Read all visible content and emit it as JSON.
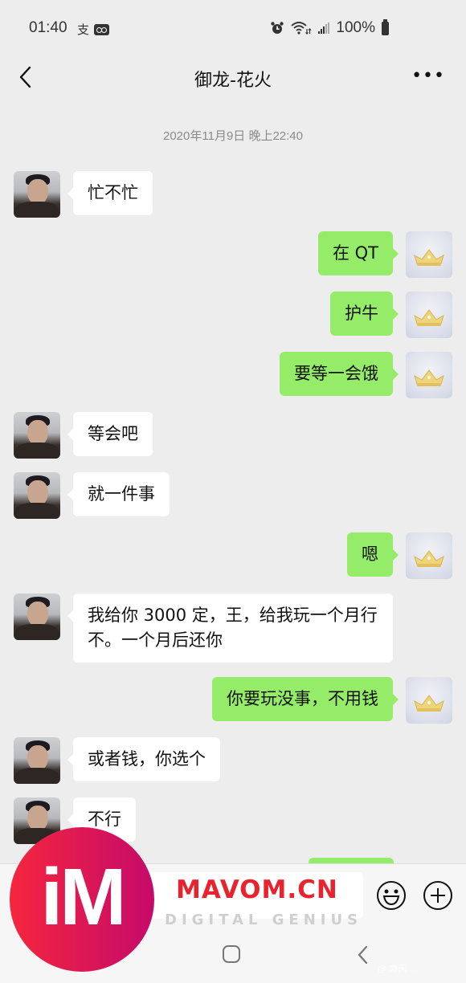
{
  "status_bar": {
    "time": "01:40",
    "left_icons": [
      "alipay-icon",
      "voicemail-icon"
    ],
    "alipay_glyph": "支",
    "right_icons": [
      "alarm-icon",
      "wifi-icon",
      "signal-icon",
      "battery-icon"
    ],
    "battery": "100%"
  },
  "header": {
    "back_icon": "chevron-left-icon",
    "title": "御龙-花火",
    "more_label": "•••"
  },
  "timestamp": "2020年11月9日 晚上22:40",
  "messages": [
    {
      "side": "left",
      "sender": "friend",
      "text": "忙不忙"
    },
    {
      "side": "right",
      "sender": "me",
      "text": "在 QT"
    },
    {
      "side": "right",
      "sender": "me",
      "text": "护牛"
    },
    {
      "side": "right",
      "sender": "me",
      "text": "要等一会饿"
    },
    {
      "side": "left",
      "sender": "friend",
      "text": "等会吧"
    },
    {
      "side": "left",
      "sender": "friend",
      "text": "就一件事"
    },
    {
      "side": "right",
      "sender": "me",
      "text": "嗯"
    },
    {
      "side": "left",
      "sender": "friend",
      "text": "我给你 3000 定，王，给我玩一个月行不。一个月后还你"
    },
    {
      "side": "right",
      "sender": "me",
      "text": "你要玩没事，不用钱"
    },
    {
      "side": "left",
      "sender": "friend",
      "text": "或者钱，你选个"
    },
    {
      "side": "left",
      "sender": "friend",
      "text": "不行"
    }
  ],
  "input_bar": {
    "input_value": "",
    "emoji_icon": "emoji-icon",
    "plus_icon": "plus-icon"
  },
  "system_nav": {
    "home_icon": "home-icon",
    "back_icon": "back-icon"
  },
  "watermark": {
    "logo_text": "iM",
    "brand": "MAVOM.CN",
    "tagline": "DIGITAL GENIUS",
    "corner_text": "@ 静闲..."
  },
  "colors": {
    "background": "#ededed",
    "bubble_me": "#95ec69",
    "bubble_friend": "#ffffff",
    "watermark_red": "#e8232e"
  }
}
